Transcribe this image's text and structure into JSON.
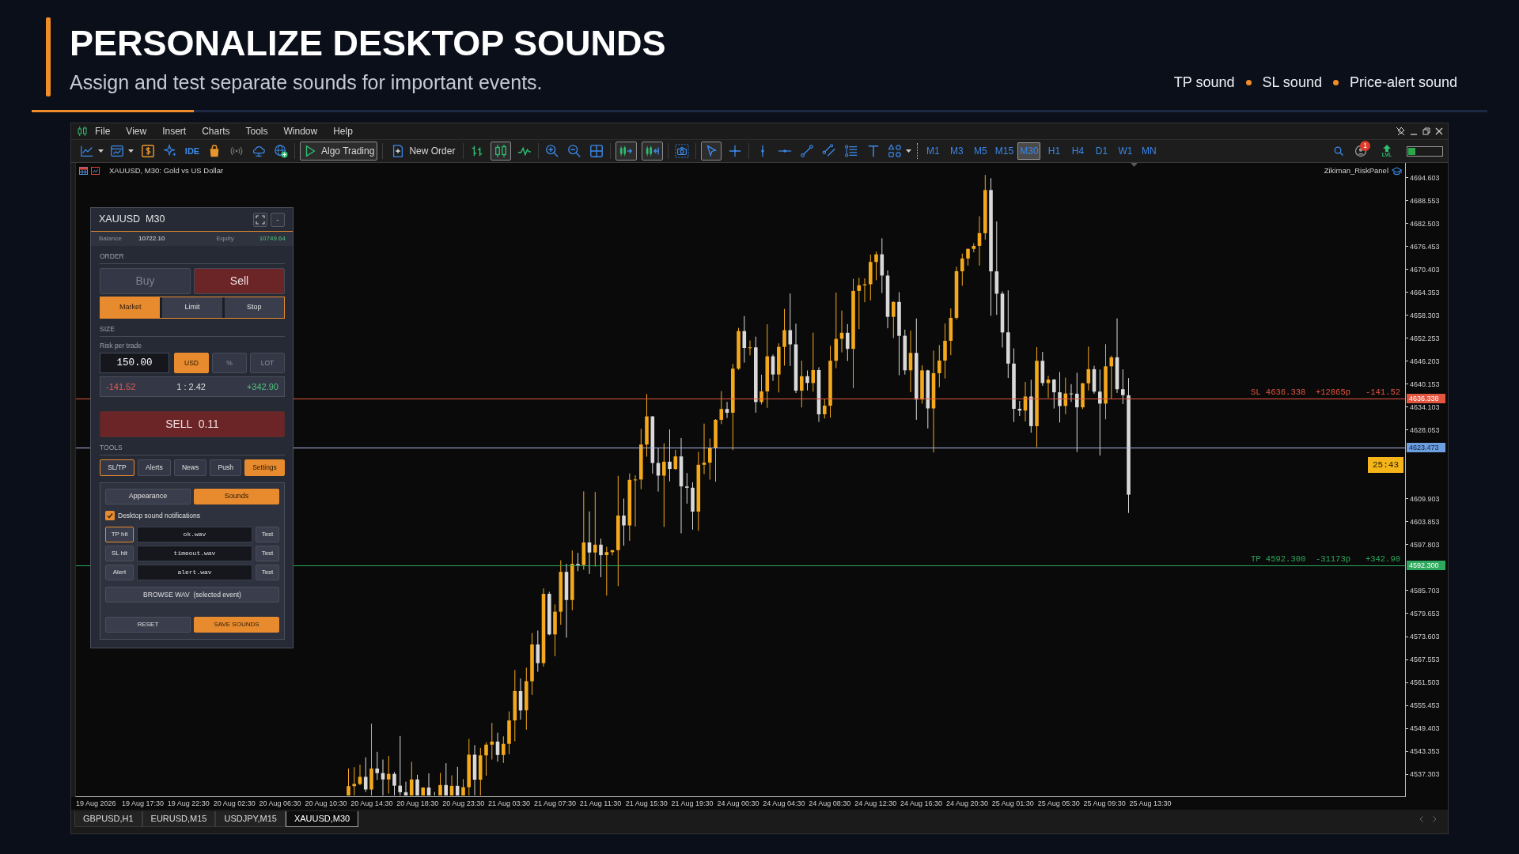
{
  "header": {
    "title": "PERSONALIZE DESKTOP SOUNDS",
    "subtitle": "Assign and test separate sounds for important events.",
    "legend": [
      "TP sound",
      "SL sound",
      "Price-alert sound"
    ]
  },
  "window": {
    "menu": [
      "File",
      "View",
      "Insert",
      "Charts",
      "Tools",
      "Window",
      "Help"
    ],
    "toolbar": {
      "tools": [
        {
          "kind": "icon",
          "on": false
        },
        {
          "kind": "icon",
          "on": false
        },
        {
          "kind": "icon",
          "on": false
        },
        {
          "kind": "icon",
          "on": false
        },
        {
          "kind": "text",
          "label": "IDE",
          "on": false
        },
        {
          "kind": "icon",
          "on": false
        },
        {
          "kind": "icon",
          "on": false
        },
        {
          "kind": "icon",
          "on": false
        },
        {
          "kind": "icon",
          "on": false
        },
        {
          "kind": "labeled",
          "label": "Algo Trading",
          "on": true
        },
        {
          "kind": "labeled",
          "label": "New Order",
          "on": false
        },
        {
          "kind": "icon",
          "on": false
        },
        {
          "kind": "icon",
          "on": true
        },
        {
          "kind": "icon",
          "on": false
        },
        {
          "kind": "icon",
          "on": false
        },
        {
          "kind": "icon",
          "on": false
        },
        {
          "kind": "icon",
          "on": false
        },
        {
          "kind": "icon",
          "on": true
        },
        {
          "kind": "icon",
          "on": true
        },
        {
          "kind": "icon",
          "on": false
        },
        {
          "kind": "icon",
          "on": true
        },
        {
          "kind": "icon",
          "on": false
        },
        {
          "kind": "icon",
          "on": false
        },
        {
          "kind": "icon",
          "on": false
        },
        {
          "kind": "icon",
          "on": false
        },
        {
          "kind": "icon",
          "on": false
        },
        {
          "kind": "icon",
          "on": false
        },
        {
          "kind": "icon",
          "on": false
        },
        {
          "kind": "icon",
          "on": false
        }
      ],
      "timeframes": [
        {
          "label": "M1",
          "selected": false
        },
        {
          "label": "M3",
          "selected": false
        },
        {
          "label": "M5",
          "selected": false
        },
        {
          "label": "M15",
          "selected": false
        },
        {
          "label": "M30",
          "selected": true
        },
        {
          "label": "H1",
          "selected": false
        },
        {
          "label": "H4",
          "selected": false
        },
        {
          "label": "D1",
          "selected": false
        },
        {
          "label": "W1",
          "selected": false
        },
        {
          "label": "MN",
          "selected": false
        }
      ],
      "notifications": "1",
      "level_button": "LVL",
      "meter": {
        "level": 0.22
      }
    },
    "chart": {
      "title": "XAUUSD, M30: Gold vs US Dollar",
      "indicator": "Zikiman_RiskPanel",
      "price_axis": [
        "4694.603",
        "4688.553",
        "4682.503",
        "4676.453",
        "4670.403",
        "4664.353",
        "4658.303",
        "4652.253",
        "4646.203",
        "4640.153",
        "4634.103",
        "4628.053",
        "4609.903",
        "4603.853",
        "4597.803",
        "4585.703",
        "4579.653",
        "4573.603",
        "4567.553",
        "4561.503",
        "4555.453",
        "4549.403",
        "4543.353",
        "4537.303"
      ],
      "time_axis": [
        "19 Aug 2026",
        "19 Aug 17:30",
        "19 Aug 22:30",
        "20 Aug 02:30",
        "20 Aug 06:30",
        "20 Aug 10:30",
        "20 Aug 14:30",
        "20 Aug 18:30",
        "20 Aug 23:30",
        "21 Aug 03:30",
        "21 Aug 07:30",
        "21 Aug 11:30",
        "21 Aug 15:30",
        "21 Aug 19:30",
        "24 Aug 00:30",
        "24 Aug 04:30",
        "24 Aug 08:30",
        "24 Aug 12:30",
        "24 Aug 16:30",
        "24 Aug 20:30",
        "25 Aug 01:30",
        "25 Aug 05:30",
        "25 Aug 09:30",
        "25 Aug 13:30"
      ],
      "lines": [
        {
          "kind": "sl",
          "label": "SL 4636.338  +12865p   -141.52",
          "price_tag": "4636.338"
        },
        {
          "kind": "price",
          "price_tag": "4623.473"
        },
        {
          "kind": "tp",
          "label": "TP 4592.300  -31173p   +342.90",
          "price_tag": "4592.300"
        }
      ],
      "timer": "25:43"
    },
    "risk_panel": {
      "symbol": "XAUUSD",
      "timeframe": "M30",
      "collapse": "-",
      "account": [
        {
          "label": "Balance",
          "value": "10722.10",
          "kind": "neutral"
        },
        {
          "label": "Equity",
          "value": "10749.64",
          "kind": "positive"
        }
      ],
      "order_label": "ORDER",
      "sides": [
        {
          "kind": "buy",
          "label": "Buy",
          "selected": false
        },
        {
          "kind": "sell",
          "label": "Sell",
          "selected": true
        }
      ],
      "order_types": [
        {
          "label": "Market",
          "selected": true
        },
        {
          "label": "Limit",
          "selected": false
        },
        {
          "label": "Stop",
          "selected": false
        }
      ],
      "size_label": "SIZE",
      "risk_label": "Risk per trade",
      "risk_value": "150.00",
      "risk_units": [
        {
          "label": "USD",
          "selected": true
        },
        {
          "label": "%",
          "selected": false
        },
        {
          "label": "LOT",
          "selected": false
        }
      ],
      "summary": {
        "loss": "-141.52",
        "ratio": "1 : 2.42",
        "profit": "+342.90"
      },
      "submit": "SELL  0.11",
      "tools_label": "TOOLS",
      "tools": [
        {
          "label": "SL/TP",
          "selected": false,
          "on": true
        },
        {
          "label": "Alerts",
          "selected": false,
          "on": false
        },
        {
          "label": "News",
          "selected": false,
          "on": false
        },
        {
          "label": "Push",
          "selected": false,
          "on": false
        },
        {
          "label": "Settings",
          "selected": true,
          "on": false
        }
      ],
      "settings": {
        "tabs": [
          {
            "label": "Appearance",
            "selected": false
          },
          {
            "label": "Sounds",
            "selected": true
          }
        ],
        "notifications": {
          "label": "Desktop sound notifications",
          "checked": true
        },
        "events": [
          {
            "label": "TP hit",
            "file": "ok.wav",
            "action": "Test",
            "selected": true
          },
          {
            "label": "SL hit",
            "file": "timeout.wav",
            "action": "Test",
            "selected": false
          },
          {
            "label": "Alert",
            "file": "alert.wav",
            "action": "Test",
            "selected": false
          }
        ],
        "browse": "BROWSE WAV  (selected event)",
        "reset": "RESET",
        "save": "SAVE SOUNDS"
      }
    },
    "tabs": [
      {
        "label": "GBPUSD,H1",
        "selected": false
      },
      {
        "label": "EURUSD,M15",
        "selected": false
      },
      {
        "label": "USDJPY,M15",
        "selected": false
      },
      {
        "label": "XAUUSD,M30",
        "selected": true
      }
    ]
  }
}
